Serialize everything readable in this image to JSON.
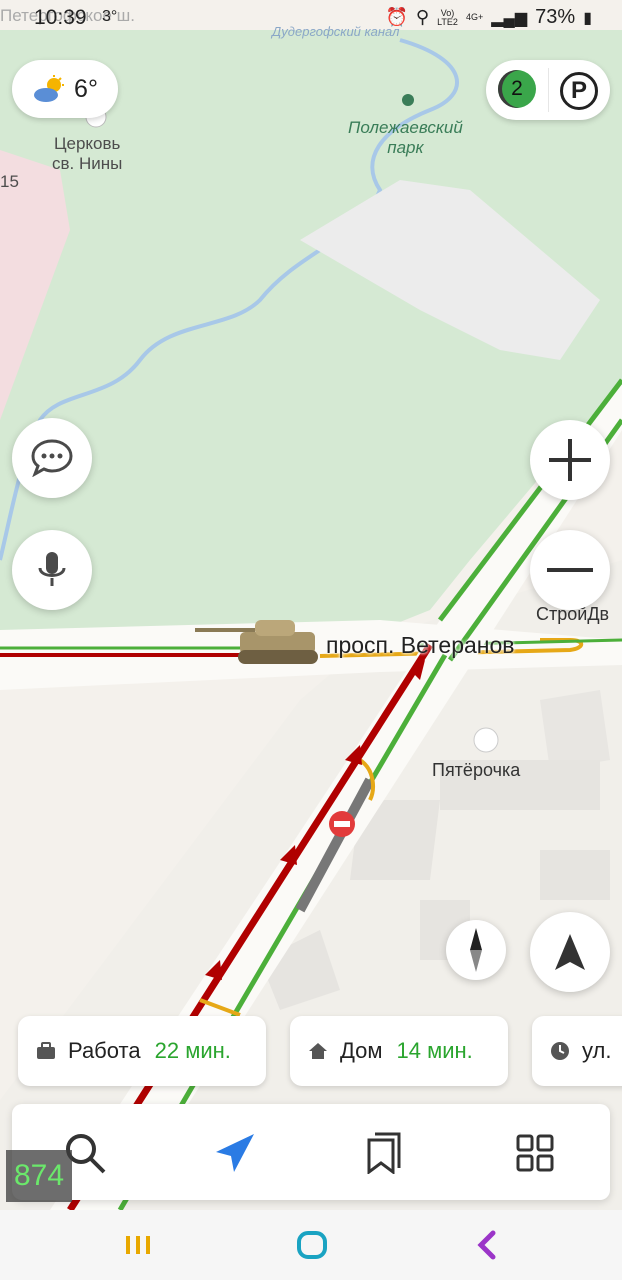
{
  "status": {
    "time": "10:39",
    "temp": "3°",
    "battery": "73%",
    "network_top": "Vo)",
    "network_bottom": "LTE2",
    "signal_label": "4G+"
  },
  "map": {
    "weather_temp": "6°",
    "faded_top_label": "Петергофское ш.",
    "faded_canal": "Дудергофский канал",
    "church_label": "Церковь\nсв. Нины",
    "park_label": "Полежаевский\nпарк",
    "left_edge_num": "15",
    "road_label": "просп. Ветеранов",
    "store_label_1": "СтройДв",
    "store_label_2": "Пятёрочка",
    "level_badge": "2",
    "parking_label": "P"
  },
  "cards": [
    {
      "label": "Работа",
      "time": "22 мин."
    },
    {
      "label": "Дом",
      "time": "14 мин."
    },
    {
      "label": "ул."
    }
  ],
  "overlay": {
    "counter": "874"
  },
  "icons": {
    "weather": "weather-partly-cloudy-icon",
    "parking": "parking-icon",
    "chat": "chat-icon",
    "mic": "microphone-icon",
    "zoom_in": "plus-icon",
    "zoom_out": "minus-icon",
    "compass": "compass-icon",
    "locate": "navigation-arrow-icon",
    "search": "search-icon",
    "route": "route-arrow-icon",
    "bookmarks": "bookmarks-icon",
    "services": "grid-icon"
  },
  "colors": {
    "park_green": "#d5e9d3",
    "river": "#a8c8e8",
    "traffic_red": "#b00000",
    "traffic_green": "#4caf3a",
    "traffic_yellow": "#e6a817",
    "accent_blue": "#2a7be4"
  }
}
